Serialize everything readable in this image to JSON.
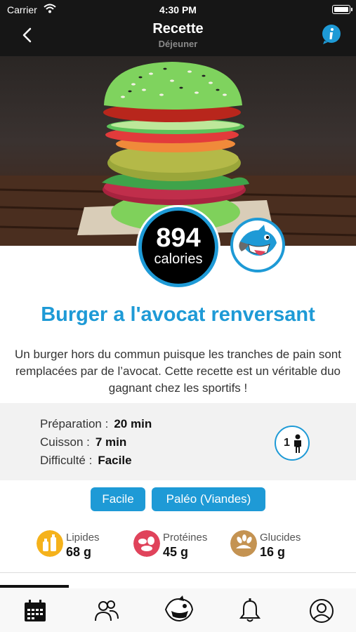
{
  "status_bar": {
    "carrier": "Carrier",
    "time": "4:30 PM"
  },
  "nav": {
    "title": "Recette",
    "subtitle": "Déjeuner",
    "back_icon": "chevron-left-icon",
    "info_icon": "info-bubble-icon"
  },
  "recipe": {
    "calories_value": "894",
    "calories_unit": "calories",
    "title": "Burger a l'avocat renversant",
    "description": "Un burger hors du commun puisque les tranches de pain sont remplacées par de l’avocat. Cette recette est un véritable duo gagnant chez les sportifs !"
  },
  "details": {
    "prep_label": "Préparation :",
    "prep_value": "20 min",
    "cook_label": "Cuisson :",
    "cook_value": "7 min",
    "difficulty_label": "Difficulté :",
    "difficulty_value": "Facile",
    "servings": "1"
  },
  "tags": [
    "Facile",
    "Paléo (Viandes)"
  ],
  "macros": [
    {
      "label": "Lipides",
      "value": "68 g",
      "color": "#f5b21b",
      "icon": "bottles-icon"
    },
    {
      "label": "Protéines",
      "value": "45 g",
      "color": "#e0435b",
      "icon": "protein-foods-icon"
    },
    {
      "label": "Glucides",
      "value": "16 g",
      "color": "#c49352",
      "icon": "grains-icon"
    }
  ],
  "tabbar": [
    "calendar-icon",
    "community-icon",
    "mascot-icon",
    "bell-icon",
    "profile-icon"
  ],
  "colors": {
    "accent": "#1e9ad6",
    "nav_bg": "#161616",
    "panel_bg": "#f2f2f2"
  }
}
